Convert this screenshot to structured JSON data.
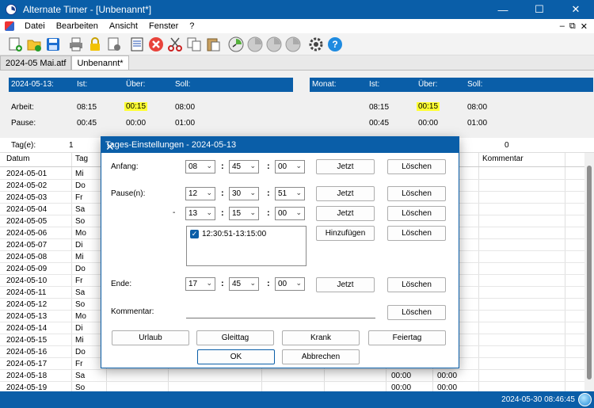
{
  "window": {
    "title": "Alternate Timer - [Unbenannt*]",
    "minimize": "—",
    "maximize": "☐",
    "close": "✕"
  },
  "menu": {
    "items": [
      "Datei",
      "Bearbeiten",
      "Ansicht",
      "Fenster",
      "?"
    ],
    "mdi_min": "–",
    "mdi_restore": "⧉",
    "mdi_close": "✕"
  },
  "toolbar": {
    "icons": [
      "new-file-icon",
      "open-folder-icon",
      "save-icon",
      "print-icon",
      "lock-icon",
      "print-settings-icon",
      "edit-entry-icon",
      "delete-icon",
      "cut-icon",
      "copy-icon",
      "paste-icon",
      "clock-green-icon",
      "clock-gray-icon",
      "clock-gray-icon",
      "clock-gray-icon",
      "settings-gear-icon",
      "help-icon"
    ]
  },
  "tabs": [
    {
      "label": "2024-05 Mai.atf"
    },
    {
      "label": "Unbenannt*"
    }
  ],
  "summary": {
    "day": {
      "date": "2024-05-13:",
      "ist": "Ist:",
      "ueber": "Über:",
      "soll": "Soll:"
    },
    "month": {
      "label": "Monat:",
      "ist": "Ist:",
      "ueber": "Über:",
      "soll": "Soll:"
    },
    "arbeit_label": "Arbeit:",
    "pause_label": "Pause:",
    "day_arbeit": {
      "ist": "08:15",
      "ueber": "00:15",
      "soll": "08:00"
    },
    "day_pause": {
      "ist": "00:45",
      "ueber": "00:00",
      "soll": "01:00"
    },
    "month_arbeit": {
      "ist": "08:15",
      "ueber": "00:15",
      "soll": "08:00"
    },
    "month_pause": {
      "ist": "00:45",
      "ueber": "00:00",
      "soll": "01:00"
    }
  },
  "tagrow": {
    "label": "Tag(e):",
    "value": "1",
    "right_value": "0"
  },
  "grid": {
    "headers": {
      "datum": "Datum",
      "tag": "Tag",
      "kommentar": "Kommentar"
    },
    "rows": [
      {
        "datum": "2024-05-01",
        "tag": "Mi"
      },
      {
        "datum": "2024-05-02",
        "tag": "Do"
      },
      {
        "datum": "2024-05-03",
        "tag": "Fr"
      },
      {
        "datum": "2024-05-04",
        "tag": "Sa"
      },
      {
        "datum": "2024-05-05",
        "tag": "So"
      },
      {
        "datum": "2024-05-06",
        "tag": "Mo"
      },
      {
        "datum": "2024-05-07",
        "tag": "Di"
      },
      {
        "datum": "2024-05-08",
        "tag": "Mi"
      },
      {
        "datum": "2024-05-09",
        "tag": "Do"
      },
      {
        "datum": "2024-05-10",
        "tag": "Fr"
      },
      {
        "datum": "2024-05-11",
        "tag": "Sa"
      },
      {
        "datum": "2024-05-12",
        "tag": "So"
      },
      {
        "datum": "2024-05-13",
        "tag": "Mo"
      },
      {
        "datum": "2024-05-14",
        "tag": "Di"
      },
      {
        "datum": "2024-05-15",
        "tag": "Mi"
      },
      {
        "datum": "2024-05-16",
        "tag": "Do"
      },
      {
        "datum": "2024-05-17",
        "tag": "Fr"
      },
      {
        "datum": "2024-05-18",
        "tag": "Sa",
        "c1": "00:00",
        "c2": "00:00"
      },
      {
        "datum": "2024-05-19",
        "tag": "So",
        "c1": "00:00",
        "c2": "00:00"
      }
    ]
  },
  "status": {
    "datetime": "2024-05-30 08:46:45"
  },
  "dialog": {
    "title": "Tages-Einstellungen - 2024-05-13",
    "close": "✕",
    "anfang": {
      "label": "Anfang:",
      "h": "08",
      "m": "45",
      "s": "00"
    },
    "pause": {
      "label": "Pause(n):",
      "h1": "12",
      "m1": "30",
      "s1": "51",
      "dash": "-",
      "h2": "13",
      "m2": "15",
      "s2": "00"
    },
    "pause_list": [
      "12:30:51-13:15:00"
    ],
    "ende": {
      "label": "Ende:",
      "h": "17",
      "m": "45",
      "s": "00"
    },
    "kommentar": {
      "label": "Kommentar:",
      "value": ""
    },
    "colon": ":",
    "buttons": {
      "jetzt": "Jetzt",
      "loeschen": "Löschen",
      "hinzufuegen": "Hinzufügen",
      "urlaub": "Urlaub",
      "gleittag": "Gleittag",
      "krank": "Krank",
      "feiertag": "Feiertag",
      "ok": "OK",
      "abbrechen": "Abbrechen"
    }
  },
  "colors": {
    "accent": "#0a5ea8",
    "highlight": "#ffff33"
  }
}
